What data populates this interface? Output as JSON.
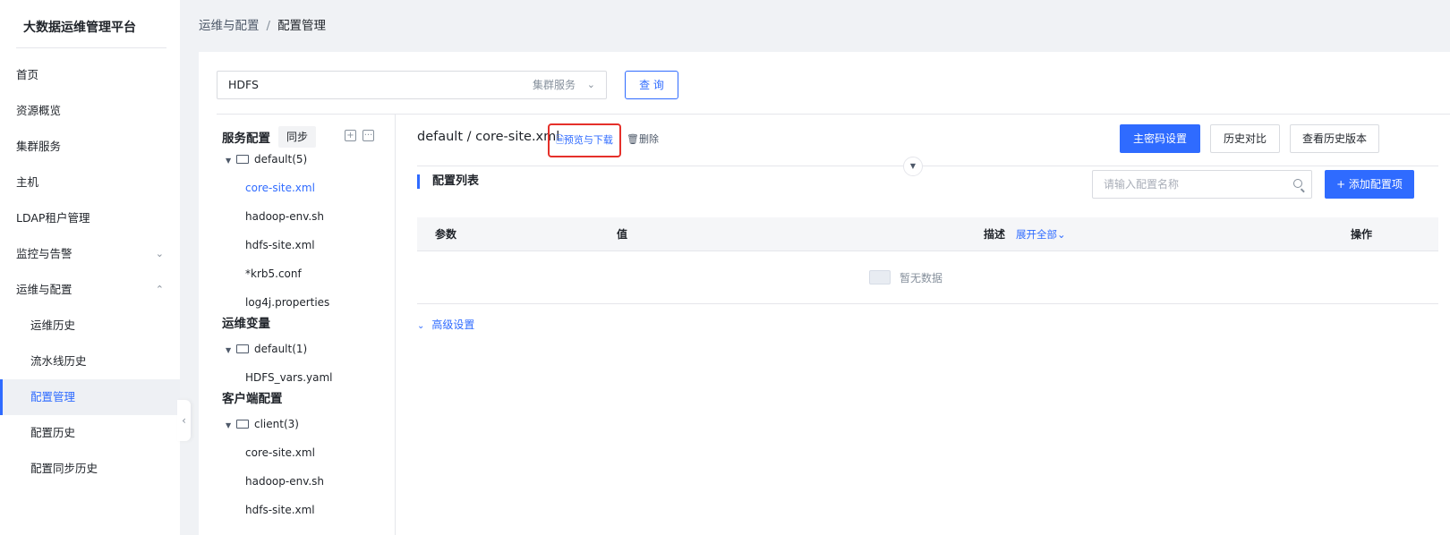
{
  "app": {
    "title": "大数据运维管理平台"
  },
  "sidebar": {
    "items": [
      {
        "label": "首页"
      },
      {
        "label": "资源概览"
      },
      {
        "label": "集群服务"
      },
      {
        "label": "主机"
      },
      {
        "label": "LDAP租户管理"
      },
      {
        "label": "监控与告警",
        "chevron": "chevron-down-icon"
      },
      {
        "label": "运维与配置",
        "chevron": "chevron-up-icon"
      },
      {
        "label": "运维历史"
      },
      {
        "label": "流水线历史"
      },
      {
        "label": "配置管理",
        "active": true
      },
      {
        "label": "配置历史"
      },
      {
        "label": "配置同步历史"
      }
    ],
    "collapse_glyph": "‹"
  },
  "breadcrumb": {
    "parent": "运维与配置",
    "separator": "/",
    "current": "配置管理"
  },
  "filter": {
    "service_value": "HDFS",
    "service_placeholder": "集群服务",
    "query_label": "查 询"
  },
  "tree": {
    "service_config": {
      "heading": "服务配置",
      "sync_label": "同步",
      "folder": "default(5)",
      "files": [
        "core-site.xml",
        "hadoop-env.sh",
        "hdfs-site.xml",
        "*krb5.conf",
        "log4j.properties"
      ]
    },
    "ops_vars": {
      "heading": "运维变量",
      "folder": "default(1)",
      "files": [
        "HDFS_vars.yaml"
      ]
    },
    "client_config": {
      "heading": "客户端配置",
      "folder": "client(3)",
      "files": [
        "core-site.xml",
        "hadoop-env.sh",
        "hdfs-site.xml"
      ]
    }
  },
  "content": {
    "title": "default / core-site.xml",
    "preview_label": "预览与下载",
    "delete_label": "删除",
    "buttons": {
      "master_password": "主密码设置",
      "history_compare": "历史对比",
      "view_history": "查看历史版本",
      "add_item": "+ 添加配置项"
    },
    "section_title": "配置列表",
    "search_placeholder": "请输入配置名称",
    "table": {
      "columns": {
        "param": "参数",
        "value": "值",
        "desc": "描述",
        "expand_all": "展开全部",
        "action": "操作"
      },
      "empty_text": "暂无数据"
    },
    "advanced_label": "高级设置"
  },
  "colors": {
    "primary": "#2f6bff",
    "highlight_box": "#e5302a"
  }
}
